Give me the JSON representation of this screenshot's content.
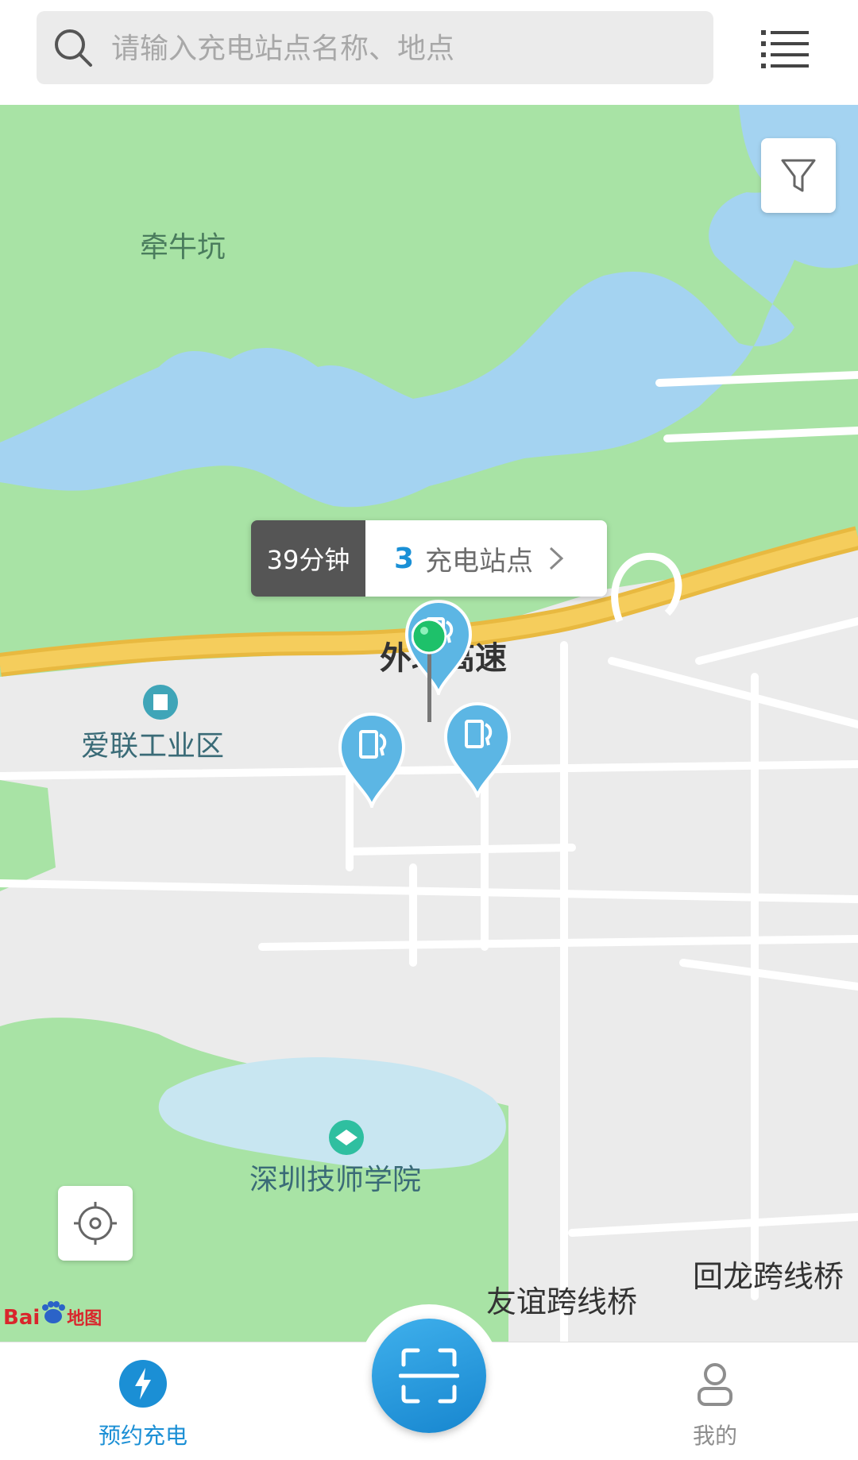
{
  "search": {
    "placeholder": "请输入充电站点名称、地点"
  },
  "map": {
    "labels": {
      "area_qianniukeng": "牵牛坑",
      "road_waihuan": "外环高速",
      "poi_ailian": "爱联工业区",
      "poi_shenzhen_tech": "深圳技师学院",
      "bridge_youyi": "友谊跨线桥",
      "bridge_huilong": "回龙跨线桥"
    },
    "provider_logo": {
      "bai": "Bai",
      "ditu": "地图"
    },
    "colors": {
      "greenery": "#a8e3a5",
      "water": "#a4d3f1",
      "land": "#ebebeb",
      "highway": "#f2c048",
      "road": "#ffffff"
    }
  },
  "station_bubble": {
    "time": "39分钟",
    "count": "3",
    "label": "充电站点"
  },
  "markers": [
    {
      "type": "charging-station"
    },
    {
      "type": "charging-station"
    },
    {
      "type": "charging-station"
    },
    {
      "type": "current-location-pin"
    }
  ],
  "tabbar": {
    "reserve_label": "预约充电",
    "mine_label": "我的",
    "active_color": "#1b8fd5"
  }
}
